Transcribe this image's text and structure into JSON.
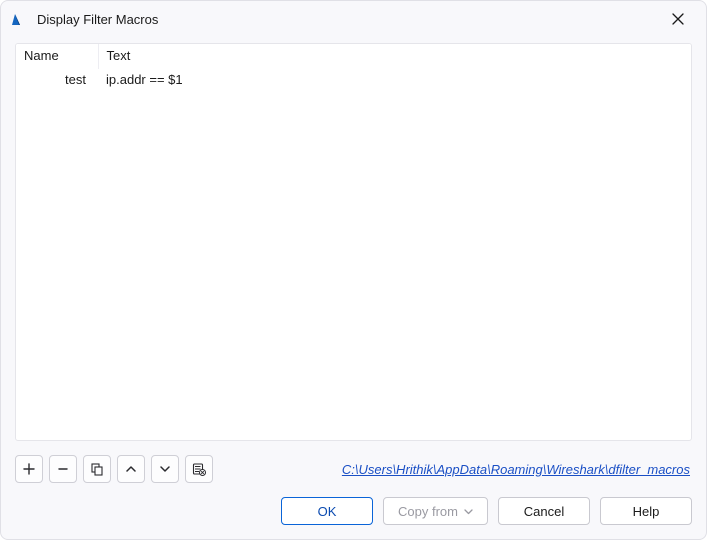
{
  "window": {
    "title": "Display Filter Macros"
  },
  "table": {
    "headers": {
      "name": "Name",
      "text": "Text"
    },
    "rows": [
      {
        "name": "test",
        "text": "ip.addr == $1"
      }
    ]
  },
  "toolbar": {
    "add": "+",
    "remove": "−",
    "copy": "copy",
    "up": "up",
    "down": "down",
    "clear": "clear"
  },
  "path": "C:\\Users\\Hrithik\\AppData\\Roaming\\Wireshark\\dfilter_macros",
  "buttons": {
    "ok": "OK",
    "copy_from": "Copy from",
    "cancel": "Cancel",
    "help": "Help"
  }
}
